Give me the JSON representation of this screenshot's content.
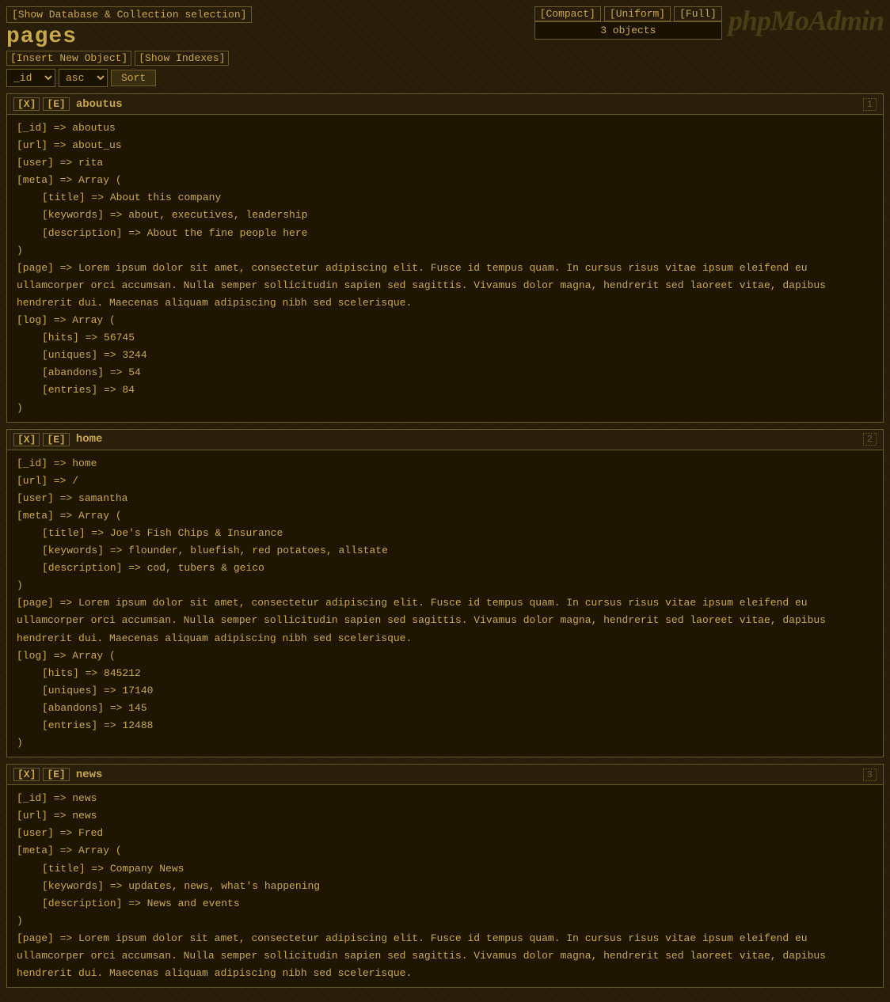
{
  "header": {
    "show_db_label": "[Show Database & Collection selection]",
    "page_title": "pages",
    "insert_link": "[Insert New Object]",
    "show_indexes_link": "[Show Indexes]",
    "view_compact": "[Compact]",
    "view_uniform": "[Uniform]",
    "view_full": "[Full]",
    "object_count": "3 objects",
    "logo": "phpMoAdmin",
    "sort_field": "_id",
    "sort_order": "asc",
    "sort_button": "Sort"
  },
  "records": [
    {
      "id": "aboutus",
      "label": "aboutus",
      "number": "1",
      "fields": {
        "_id": "aboutus",
        "url": "about_us",
        "user": "rita",
        "meta_title": "About this company",
        "meta_keywords": "about, executives, leadership",
        "meta_description": "About the fine people here",
        "page_text": "Lorem ipsum dolor sit amet, consectetur adipiscing elit. Fusce id tempus quam. In cursus risus vitae ipsum eleifend eu ullamcorper orci accumsan. Nulla semper sollicitudin sapien sed sagittis. Vivamus dolor magna, hendrerit sed laoreet vitae, dapibus hendrerit dui. Maecenas aliquam adipiscing nibh sed scelerisque.",
        "log_hits": "56745",
        "log_uniques": "3244",
        "log_abandons": "54",
        "log_entries": "84"
      }
    },
    {
      "id": "home",
      "label": "home",
      "number": "2",
      "fields": {
        "_id": "home",
        "url": "/",
        "user": "samantha",
        "meta_title": "Joe's Fish Chips & Insurance",
        "meta_keywords": "flounder, bluefish, red potatoes, allstate",
        "meta_description": "cod, tubers & geico",
        "page_text": "Lorem ipsum dolor sit amet, consectetur adipiscing elit. Fusce id tempus quam. In cursus risus vitae ipsum eleifend eu ullamcorper orci accumsan. Nulla semper sollicitudin sapien sed sagittis. Vivamus dolor magna, hendrerit sed laoreet vitae, dapibus hendrerit dui. Maecenas aliquam adipiscing nibh sed scelerisque.",
        "log_hits": "845212",
        "log_uniques": "17140",
        "log_abandons": "145",
        "log_entries": "12488"
      }
    },
    {
      "id": "news",
      "label": "news",
      "number": "3",
      "fields": {
        "_id": "news",
        "url": "news",
        "user": "Fred",
        "meta_title": "Company News",
        "meta_keywords": "updates, news, what's happening",
        "meta_description": "News and events",
        "page_text": "Lorem ipsum dolor sit amet, consectetur adipiscing elit. Fusce id tempus quam. In cursus risus vitae ipsum eleifend eu ullamcorper orci accumsan. Nulla semper sollicitudin sapien sed sagittis. Vivamus dolor magna, hendrerit sed laoreet vitae, dapibus hendrerit dui. Maecenas aliquam adipiscing nibh sed scelerisque.",
        "log_hits": "",
        "log_uniques": "",
        "log_abandons": "",
        "log_entries": ""
      }
    }
  ]
}
